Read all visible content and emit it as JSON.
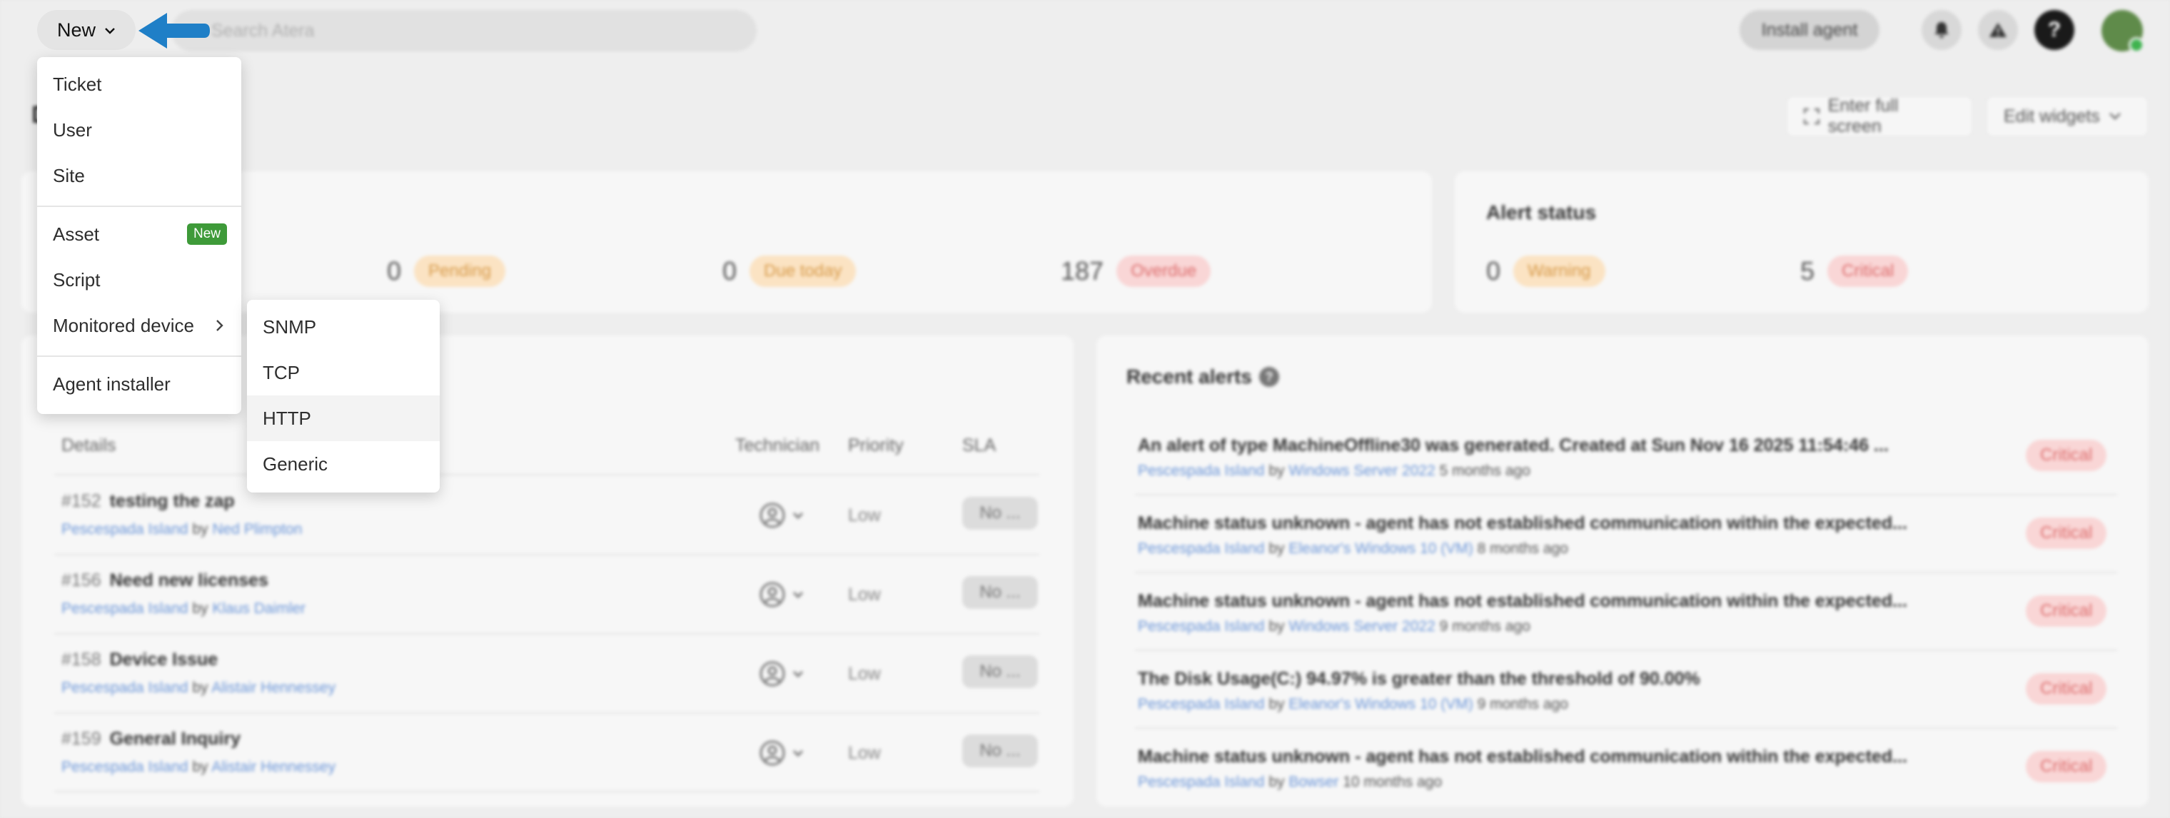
{
  "header": {
    "new_label": "New",
    "search_placeholder": "Search Atera",
    "install_agent": "Install agent"
  },
  "new_menu": {
    "items": [
      {
        "label": "Ticket"
      },
      {
        "label": "User"
      },
      {
        "label": "Site"
      },
      {
        "label": "Asset",
        "badge": "New"
      },
      {
        "label": "Script"
      },
      {
        "label": "Monitored device"
      },
      {
        "label": "Agent installer"
      }
    ],
    "submenu": [
      "SNMP",
      "TCP",
      "HTTP",
      "Generic"
    ]
  },
  "page": {
    "title_initial": "D",
    "full_screen": "Enter full screen",
    "edit_widgets": "Edit widgets"
  },
  "ticket_status": {
    "pending": {
      "count": "0",
      "label": "Pending"
    },
    "due_today": {
      "count": "0",
      "label": "Due today"
    },
    "overdue": {
      "count": "187",
      "label": "Overdue"
    }
  },
  "alert_status": {
    "title": "Alert status",
    "warning": {
      "count": "0",
      "label": "Warning"
    },
    "critical": {
      "count": "5",
      "label": "Critical"
    }
  },
  "tickets": {
    "columns": [
      "Details",
      "Technician",
      "Priority",
      "SLA"
    ],
    "rows": [
      {
        "num": "#152",
        "title": "testing the zap",
        "site": "Pescespada Island",
        "by": "by",
        "user": "Ned Plimpton",
        "priority": "Low",
        "sla": "No ..."
      },
      {
        "num": "#156",
        "title": "Need new licenses",
        "site": "Pescespada Island",
        "by": "by",
        "user": "Klaus Daimler",
        "priority": "Low",
        "sla": "No ..."
      },
      {
        "num": "#158",
        "title": "Device Issue",
        "site": "Pescespada Island",
        "by": "by",
        "user": "Alistair Hennessey",
        "priority": "Low",
        "sla": "No ..."
      },
      {
        "num": "#159",
        "title": "General Inquiry",
        "site": "Pescespada Island",
        "by": "by",
        "user": "Alistair Hennessey",
        "priority": "Low",
        "sla": "No ..."
      }
    ]
  },
  "recent_alerts": {
    "title": "Recent alerts",
    "rows": [
      {
        "title": "An alert of type MachineOffline30 was generated. Created at Sun Nov 16 2025 11:54:46 ...",
        "site": "Pescespada Island",
        "by": "by",
        "device": "Windows Server 2022",
        "ago": "5 months ago",
        "severity": "Critical"
      },
      {
        "title": "Machine status unknown - agent has not established communication within the expected...",
        "site": "Pescespada Island",
        "by": "by",
        "device": "Eleanor's Windows 10 (VM)",
        "ago": "8 months ago",
        "severity": "Critical"
      },
      {
        "title": "Machine status unknown - agent has not established communication within the expected...",
        "site": "Pescespada Island",
        "by": "by",
        "device": "Windows Server 2022",
        "ago": "9 months ago",
        "severity": "Critical"
      },
      {
        "title": "The Disk Usage(C:) 94.97% is greater than the threshold of 90.00%",
        "site": "Pescespada Island",
        "by": "by",
        "device": "Eleanor's Windows 10 (VM)",
        "ago": "9 months ago",
        "severity": "Critical"
      },
      {
        "title": "Machine status unknown - agent has not established communication within the expected...",
        "site": "Pescespada Island",
        "by": "by",
        "device": "Bowser",
        "ago": "10 months ago",
        "severity": "Critical"
      }
    ]
  },
  "colors": {
    "badge_green": "#3e9a39",
    "pointer_blue": "#1f7fc7",
    "critical_red": "#dd6d6d",
    "warning_amber": "#d79a49"
  }
}
